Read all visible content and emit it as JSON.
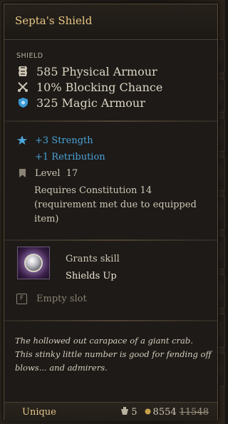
{
  "item": {
    "name": "Septa's Shield",
    "type": "SHIELD",
    "stats": [
      {
        "icon": "armour-icon",
        "value": "585",
        "label": "Physical Armour"
      },
      {
        "icon": "crossed-swords-icon",
        "value": "10%",
        "label": "Blocking Chance"
      },
      {
        "icon": "magic-shield-icon",
        "value": "325",
        "label": "Magic Armour"
      }
    ],
    "bonuses": [
      "+3 Strength",
      "+1 Retribution"
    ],
    "level": "Level  17",
    "requirement": "Requires Constitution 14 (requirement met due to equipped item)",
    "skill": {
      "grant_label": "Grants skill",
      "name": "Shields Up"
    },
    "empty_slot": {
      "key": "F",
      "label": "Empty slot"
    },
    "description": "The hollowed out carapace of a giant crab. This stinky little number is good for fending off blows... and admirers.",
    "rarity": "Unique",
    "weight": "5",
    "value_current": "8554",
    "value_original": "11548"
  },
  "colors": {
    "title": "#e8c787",
    "bonus": "#4aa3d8",
    "rarity": "#e4c78b"
  }
}
